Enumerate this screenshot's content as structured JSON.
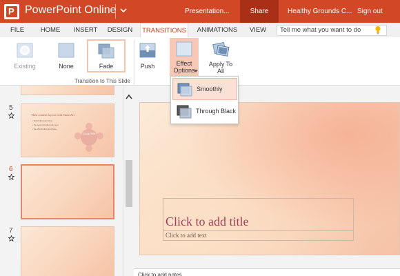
{
  "titlebar": {
    "app_logo_letter": "P",
    "app_name": "PowerPoint Online",
    "document_name": "Presentation...",
    "share_label": "Share",
    "site_name": "Healthy Grounds C...",
    "signout_label": "Sign out"
  },
  "tabs": [
    {
      "label": "FILE"
    },
    {
      "label": "HOME"
    },
    {
      "label": "INSERT"
    },
    {
      "label": "DESIGN"
    },
    {
      "label": "TRANSITIONS",
      "active": true
    },
    {
      "label": "ANIMATIONS"
    },
    {
      "label": "VIEW"
    }
  ],
  "tell_me": {
    "value": "Tell me what you want to do"
  },
  "ribbon": {
    "existing_label": "Existing",
    "none_label": "None",
    "fade_label": "Fade",
    "push_label": "Push",
    "effect_options_line1": "Effect",
    "effect_options_line2": "Options",
    "apply_all_line1": "Apply To",
    "apply_all_line2": "All",
    "group_caption": "Transition to This Slide"
  },
  "effect_dropdown": {
    "items": [
      {
        "label": "Smoothly",
        "selected": true
      },
      {
        "label": "Through Black",
        "selected": false
      }
    ]
  },
  "slides": [
    {
      "number": "5",
      "title": "Then content layout with SmartArt",
      "bullets": [
        "• first bullet point here",
        "• the second bullet point text",
        "• the third bullet point here"
      ],
      "smartart_center": "Group Title"
    },
    {
      "number": "6",
      "selected": true
    },
    {
      "number": "7"
    }
  ],
  "main_slide": {
    "title_placeholder": "Click to add title",
    "subtitle_placeholder": "Click to add text"
  },
  "notes": {
    "label": "Click to add notes"
  },
  "colors": {
    "brand": "#d24726",
    "share_bg": "#a92f16",
    "active_tab_text": "#c5391c",
    "title_text": "#a43f5b",
    "dropdown_selected": "#fbe0d5"
  }
}
